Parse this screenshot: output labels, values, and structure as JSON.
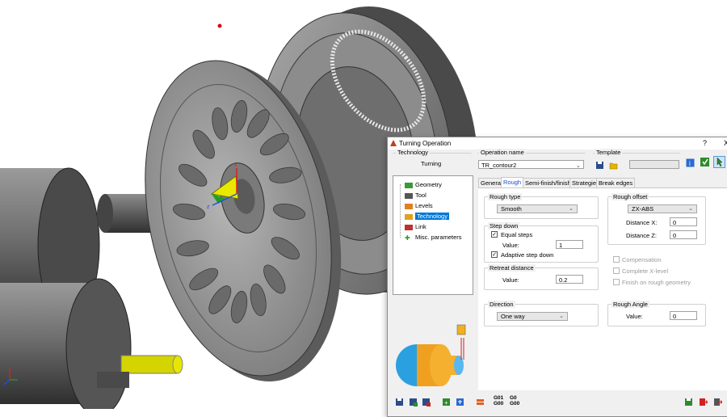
{
  "dialog": {
    "title": "Turning Operation",
    "help": "?",
    "close": "X"
  },
  "technology": {
    "label": "Technology",
    "value": "Turning"
  },
  "operation_name": {
    "label": "Operation name",
    "value": "TR_contour2"
  },
  "template": {
    "label": "Template",
    "value": ""
  },
  "tree": {
    "items": [
      {
        "label": "Geometry",
        "icon": "geometry-icon"
      },
      {
        "label": "Tool",
        "icon": "tool-icon"
      },
      {
        "label": "Levels",
        "icon": "levels-icon"
      },
      {
        "label": "Technology",
        "icon": "technology-icon",
        "selected": true
      },
      {
        "label": "Link",
        "icon": "link-icon"
      },
      {
        "label": "Misc. parameters",
        "icon": "plus-icon"
      }
    ]
  },
  "tabs": [
    "General",
    "Rough",
    "Semi-finish/finish",
    "Strategies",
    "Break edges"
  ],
  "rough_type": {
    "label": "Rough type",
    "value": "Smooth"
  },
  "step_down": {
    "label": "Step down",
    "equal_steps": "Equal steps",
    "value_label": "Value:",
    "value": "1",
    "adaptive": "Adaptive step down"
  },
  "retreat": {
    "label": "Retreat distance",
    "value_label": "Value:",
    "value": "0.2"
  },
  "direction": {
    "label": "Direction",
    "value": "One way"
  },
  "rough_offset": {
    "label": "Rough offset",
    "value": "ZX-ABS",
    "distance_x_label": "Distance X:",
    "distance_x": "0",
    "distance_z_label": "Distance Z:",
    "distance_z": "0"
  },
  "options": {
    "compensation": "Compensation",
    "complete_x": "Complete X-level",
    "finish_on_rough": "Finish on rough geometry"
  },
  "rough_angle": {
    "label": "Rough Angle",
    "value_label": "Value:",
    "value": "0"
  },
  "gcode": {
    "g01": "G01",
    "g00": "G00",
    "g01b": "G0",
    "g00b": "G00"
  },
  "viewport": {
    "axis_z": "z",
    "axis_x": "x"
  },
  "colors": {
    "accent": "#0078d7",
    "yellow": "#e6e600",
    "model_gray": "#7a7a7a"
  }
}
